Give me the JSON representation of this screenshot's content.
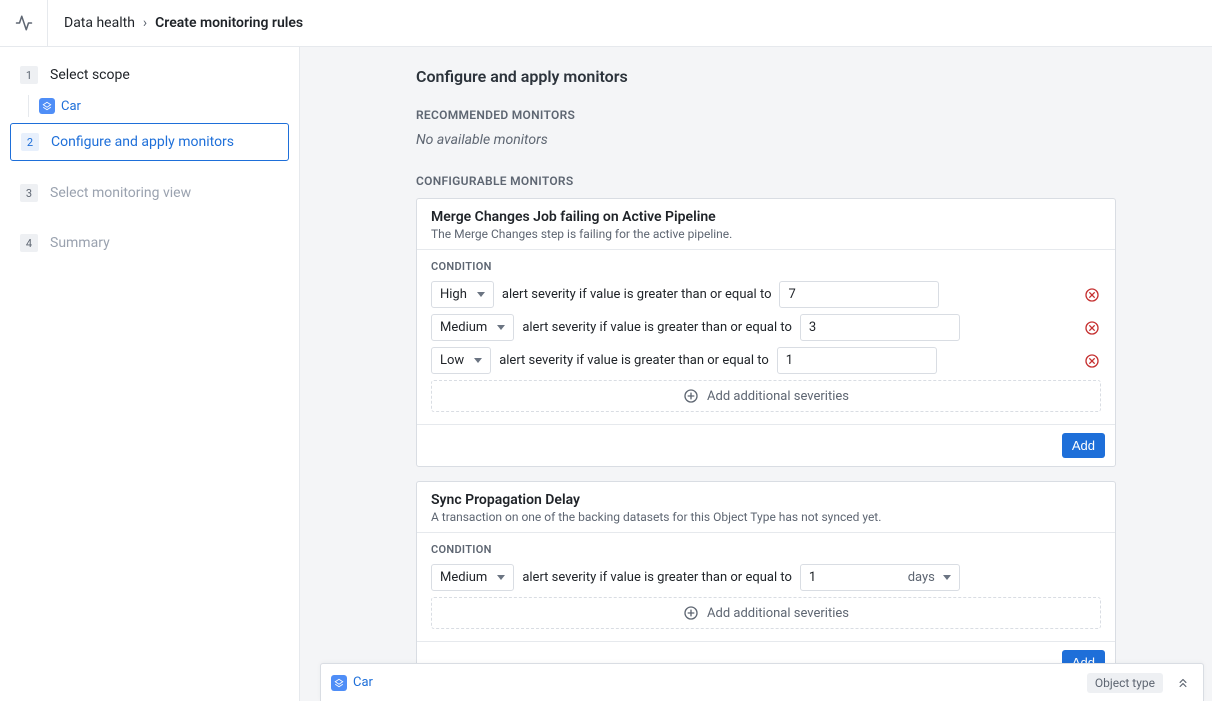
{
  "breadcrumb": {
    "root": "Data health",
    "current": "Create monitoring rules"
  },
  "stepper": {
    "steps": [
      {
        "num": "1",
        "label": "Select scope"
      },
      {
        "num": "2",
        "label": "Configure and apply monitors"
      },
      {
        "num": "3",
        "label": "Select monitoring view"
      },
      {
        "num": "4",
        "label": "Summary"
      }
    ],
    "scope_item": "Car"
  },
  "main": {
    "title": "Configure and apply monitors",
    "recommended_label": "RECOMMENDED MONITORS",
    "no_available": "No available monitors",
    "configurable_label": "CONFIGURABLE MONITORS",
    "condition_label": "CONDITION",
    "condition_text": "alert severity if value is greater than or equal to",
    "add_severities": "Add additional severities",
    "add_btn": "Add"
  },
  "monitors": [
    {
      "title": "Merge Changes Job failing on Active Pipeline",
      "desc": "The Merge Changes step is failing for the active pipeline.",
      "conditions": [
        {
          "severity": "High",
          "value": "7"
        },
        {
          "severity": "Medium",
          "value": "3"
        },
        {
          "severity": "Low",
          "value": "1"
        }
      ]
    },
    {
      "title": "Sync Propagation Delay",
      "desc": "A transaction on one of the backing datasets for this Object Type has not synced yet.",
      "conditions": [
        {
          "severity": "Medium",
          "value": "1",
          "unit": "days"
        }
      ]
    }
  ],
  "bottom": {
    "item": "Car",
    "badge": "Object type"
  }
}
